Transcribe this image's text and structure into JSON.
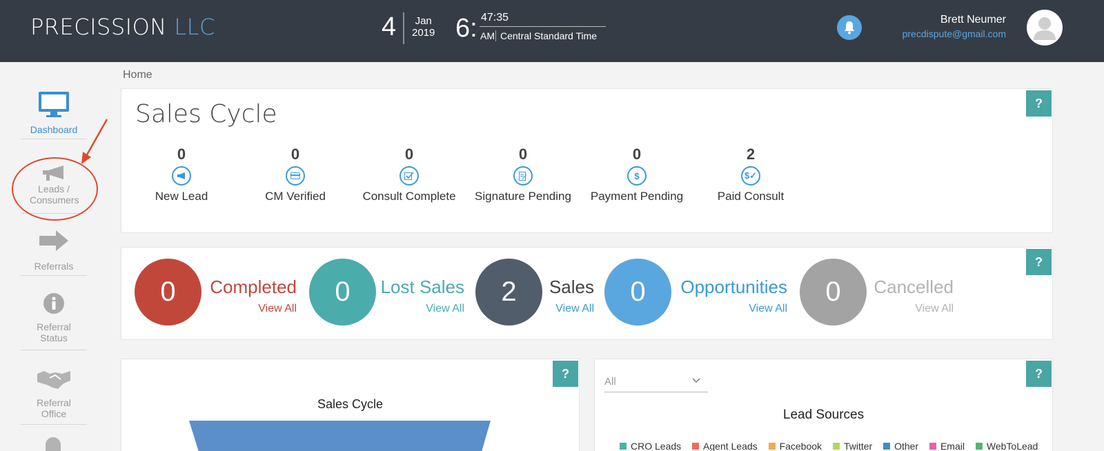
{
  "header": {
    "brand_main": "PRECISSION",
    "brand_accent": "LLC",
    "day": "4",
    "month": "Jan",
    "year": "2019",
    "hour": "6:",
    "minutes": "47:35",
    "ampm": "AM",
    "timezone": "Central Standard Time",
    "user_name": "Brett Neumer",
    "user_email": "precdispute@gmail.com"
  },
  "sidebar": {
    "items": [
      {
        "label": "Dashboard"
      },
      {
        "label": "Leads / Consumers"
      },
      {
        "label": "Referrals"
      },
      {
        "label": "Referral Status"
      },
      {
        "label": "Referral Office"
      }
    ]
  },
  "breadcrumb": "Home",
  "sales_cycle": {
    "title": "Sales Cycle",
    "help": "?",
    "stages": [
      {
        "count": "0",
        "label": "New Lead"
      },
      {
        "count": "0",
        "label": "CM Verified"
      },
      {
        "count": "0",
        "label": "Consult Complete"
      },
      {
        "count": "0",
        "label": "Signature Pending"
      },
      {
        "count": "0",
        "label": "Payment Pending"
      },
      {
        "count": "2",
        "label": "Paid Consult"
      }
    ]
  },
  "stats": {
    "help": "?",
    "items": [
      {
        "value": "0",
        "name": "Completed",
        "link": "View All",
        "color": "#c1473b"
      },
      {
        "value": "0",
        "name": "Lost Sales",
        "link": "View All",
        "color": "#4aacab"
      },
      {
        "value": "2",
        "name": "Sales",
        "link": "View All",
        "color": "#525d6b"
      },
      {
        "value": "0",
        "name": "Opportunities",
        "link": "View All",
        "color": "#5aa6df"
      },
      {
        "value": "0",
        "name": "Cancelled",
        "link": "View All",
        "color": "#a3a3a3"
      }
    ]
  },
  "funnel_panel": {
    "title": "Sales Cycle",
    "help": "?"
  },
  "lead_sources": {
    "filter_value": "All",
    "title": "Lead Sources",
    "help": "?",
    "legend": [
      {
        "name": "CRO Leads",
        "color": "#3fb8a4"
      },
      {
        "name": "Agent Leads",
        "color": "#ef6b57"
      },
      {
        "name": "Facebook",
        "color": "#f5a94f"
      },
      {
        "name": "Twitter",
        "color": "#b0d95a"
      },
      {
        "name": "Other",
        "color": "#3c8fc6"
      },
      {
        "name": "Email",
        "color": "#ef5ea7"
      },
      {
        "name": "WebToLead",
        "color": "#4fb86d"
      }
    ]
  }
}
